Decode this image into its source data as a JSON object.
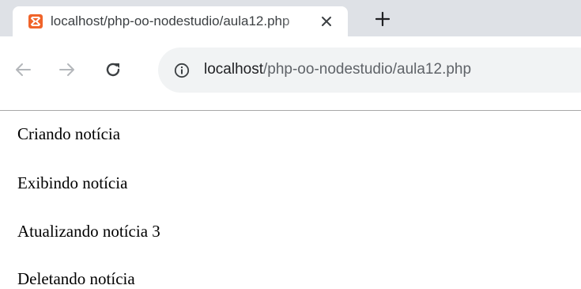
{
  "tab": {
    "title": "localhost/php-oo-nodestudio/aula12.php",
    "favicon": "xampp-icon"
  },
  "toolbar": {
    "back_icon": "back-arrow-icon",
    "forward_icon": "forward-arrow-icon",
    "reload_icon": "reload-icon",
    "url_host": "localhost",
    "url_path": "/php-oo-nodestudio/aula12.php"
  },
  "content": {
    "lines": [
      "Criando notícia",
      "Exibindo notícia",
      "Atualizando notícia 3",
      "Deletando notícia"
    ]
  },
  "colors": {
    "tabstrip": "#dee1e6",
    "omnibox": "#f1f3f4",
    "favicon": "#f0642a"
  }
}
